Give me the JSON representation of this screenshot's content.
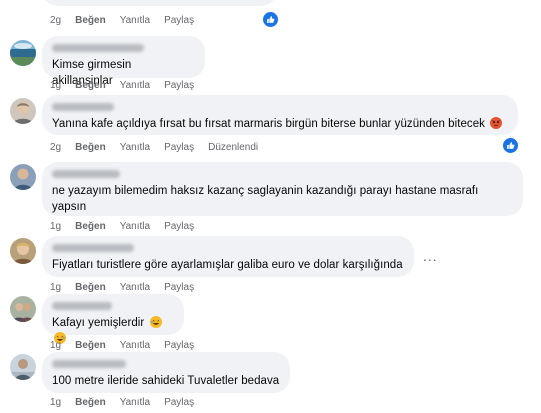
{
  "top_comment": {
    "time": "2g",
    "like_label": "Beğen",
    "reply_label": "Yanıtla",
    "share_label": "Paylaş"
  },
  "comments": [
    {
      "text": "Kimse girmesin akillansinlar",
      "time": "1g",
      "like_label": "Beğen",
      "reply_label": "Yanıtla",
      "share_label": "Paylaş"
    },
    {
      "text": "Yanına kafe açıldıya fırsat bu fırsat marmaris birgün biterse bunlar yüzünden bitecek",
      "time": "2g",
      "like_label": "Beğen",
      "reply_label": "Yanıtla",
      "share_label": "Paylaş",
      "edited_label": "Düzenlendi"
    },
    {
      "text": "ne yazayım bilemedim haksız kazanç saglayanin kazandığı parayı hastane masrafı yapsın",
      "time": "1g",
      "like_label": "Beğen",
      "reply_label": "Yanıtla",
      "share_label": "Paylaş"
    },
    {
      "text": "Fiyatları turistlere göre ayarlamışlar galiba euro ve dolar karşılığında",
      "time": "1g",
      "like_label": "Beğen",
      "reply_label": "Yanıtla",
      "share_label": "Paylaş",
      "more_label": "..."
    },
    {
      "text": "Kafayı yemişlerdir",
      "time": "1g",
      "like_label": "Beğen",
      "reply_label": "Yanıtla",
      "share_label": "Paylaş"
    },
    {
      "text": "100 metre ileride sahideki Tuvaletler bedava",
      "time": "1g",
      "like_label": "Beğen",
      "reply_label": "Yanıtla",
      "share_label": "Paylaş"
    }
  ],
  "icons": {
    "like_reaction": "thumbs-up-icon",
    "angry_emoji": "angry-face-icon",
    "laughing_emoji": "rolling-laughing-face-icon"
  },
  "colors": {
    "bubble": "#f0f2f5",
    "meta_text": "#65676b",
    "like_blue": "#1b74e4",
    "angry": "#e4532f",
    "laugh": "#f7b928"
  }
}
